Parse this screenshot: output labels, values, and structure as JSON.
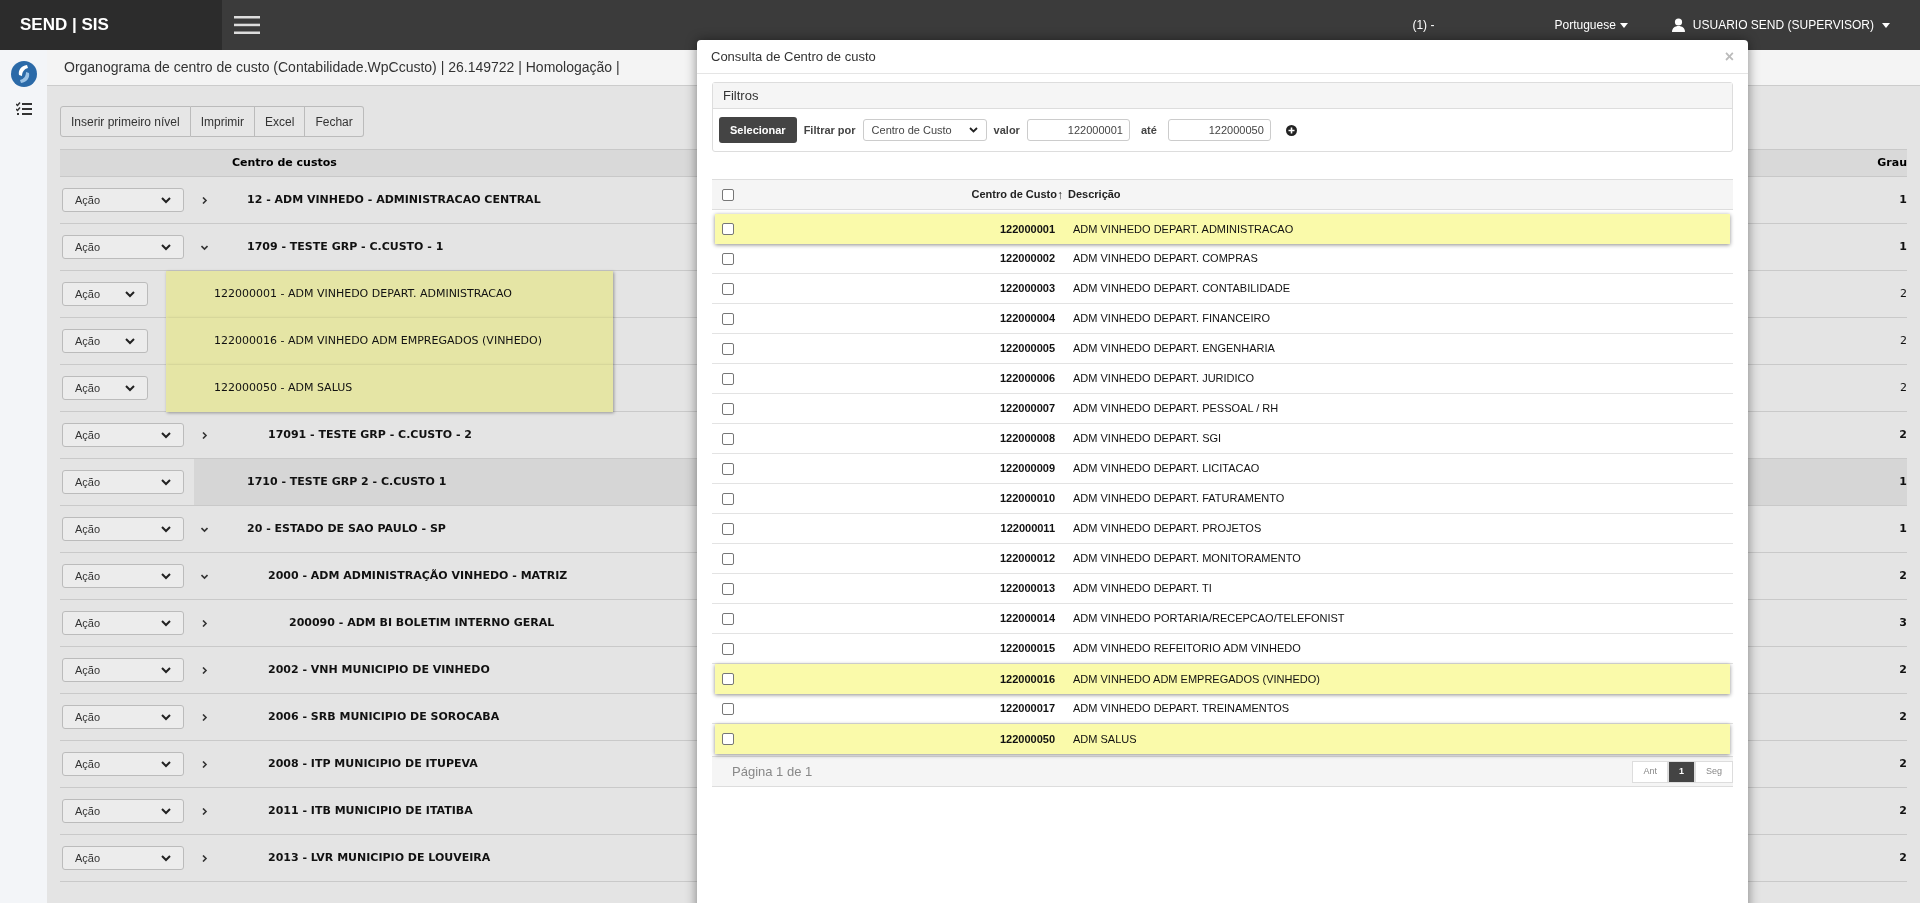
{
  "topbar": {
    "brand": "SEND | SIS",
    "notice": "(1) -",
    "language": "Portuguese",
    "user": "USUARIO SEND (SUPERVISOR)"
  },
  "breadcrumb": "Organograma de centro de custo (Contabilidade.WpCcusto) | 26.149722 | Homologação |",
  "toolbar": [
    "Inserir primeiro nível",
    "Imprimir",
    "Excel",
    "Fechar"
  ],
  "tree": {
    "columns": [
      "Centro de custos",
      "Grau"
    ],
    "rows": [
      {
        "kind": "group",
        "label": "12 - ADM VINHEDO - ADMINISTRACAO CENTRAL",
        "grau": "1",
        "action": "Ação",
        "selected": false,
        "expanded": false
      },
      {
        "kind": "group",
        "label": "1709 - TESTE GRP - C.CUSTO - 1",
        "grau": "1",
        "action": "Ação",
        "selected": false,
        "expanded": true,
        "children": [
          {
            "kind": "account",
            "label": "122000001 - ADM VINHEDO DEPART. ADMINISTRACAO",
            "grau": "2",
            "action": "Ação",
            "selected": false
          },
          {
            "kind": "account",
            "label": "122000016 - ADM VINHEDO ADM EMPREGADOS (VINHEDO)",
            "grau": "2",
            "action": "Ação",
            "selected": false
          },
          {
            "kind": "account",
            "label": "122000050 - ADM SALUS",
            "grau": "2",
            "action": "Ação",
            "selected": false
          },
          {
            "kind": "group",
            "label": "17091 - TESTE GRP - C.CUSTO - 2",
            "grau": "2",
            "action": "Ação",
            "selected": false,
            "expanded": false
          }
        ]
      },
      {
        "kind": "leaf",
        "label": "1710 - TESTE GRP 2 - C.CUSTO 1",
        "grau": "1",
        "action": "Ação",
        "selected": true
      },
      {
        "kind": "group",
        "label": "20 - ESTADO DE SAO PAULO - SP",
        "grau": "1",
        "action": "Ação",
        "selected": false,
        "expanded": true,
        "children": [
          {
            "kind": "group",
            "label": "2000 - ADM ADMINISTRAÇÃO VINHEDO - MATRIZ",
            "grau": "2",
            "action": "Ação",
            "selected": false,
            "expanded": true,
            "children": [
              {
                "kind": "group",
                "label": "200090 - ADM BI BOLETIM INTERNO GERAL",
                "grau": "3",
                "action": "Ação",
                "selected": false,
                "expanded": false
              }
            ]
          },
          {
            "kind": "group",
            "label": "2002 - VNH MUNICIPIO DE VINHEDO",
            "grau": "2",
            "action": "Ação",
            "selected": false,
            "expanded": false
          },
          {
            "kind": "group",
            "label": "2006 - SRB MUNICIPIO DE SOROCABA",
            "grau": "2",
            "action": "Ação",
            "selected": false,
            "expanded": false
          },
          {
            "kind": "group",
            "label": "2008 - ITP MUNICIPIO DE ITUPEVA",
            "grau": "2",
            "action": "Ação",
            "selected": false,
            "expanded": false
          },
          {
            "kind": "group",
            "label": "2011 - ITB MUNICIPIO DE ITATIBA",
            "grau": "2",
            "action": "Ação",
            "selected": false,
            "expanded": false
          },
          {
            "kind": "group",
            "label": "2013 - LVR MUNICIPIO DE LOUVEIRA",
            "grau": "2",
            "action": "Ação",
            "selected": false,
            "expanded": false
          }
        ]
      }
    ]
  },
  "modal": {
    "title": "Consulta de Centro de custo",
    "close": "×",
    "filters": {
      "title": "Filtros",
      "button": "Selecionar",
      "filter_label": "Filtrar por",
      "filter_select": "Centro de Custo",
      "value_label": "valor",
      "value": "122000001",
      "until_label": "até",
      "until_value": "122000050"
    },
    "table": {
      "columns": [
        "Centro de Custo",
        "Descrição"
      ],
      "sort_indicator": "↑",
      "all_checked": false,
      "rows": [
        {
          "code": "122000001",
          "description": "ADM VINHEDO DEPART. ADMINISTRACAO",
          "checked": false,
          "selected": true
        },
        {
          "code": "122000002",
          "description": "ADM VINHEDO DEPART. COMPRAS",
          "checked": false,
          "selected": false
        },
        {
          "code": "122000003",
          "description": "ADM VINHEDO DEPART. CONTABILIDADE",
          "checked": false,
          "selected": false
        },
        {
          "code": "122000004",
          "description": "ADM VINHEDO DEPART. FINANCEIRO",
          "checked": false,
          "selected": false
        },
        {
          "code": "122000005",
          "description": "ADM VINHEDO DEPART. ENGENHARIA",
          "checked": false,
          "selected": false
        },
        {
          "code": "122000006",
          "description": "ADM VINHEDO DEPART. JURIDICO",
          "checked": false,
          "selected": false
        },
        {
          "code": "122000007",
          "description": "ADM VINHEDO DEPART. PESSOAL / RH",
          "checked": false,
          "selected": false
        },
        {
          "code": "122000008",
          "description": "ADM VINHEDO DEPART. SGI",
          "checked": false,
          "selected": false
        },
        {
          "code": "122000009",
          "description": "ADM VINHEDO DEPART. LICITACAO",
          "checked": false,
          "selected": false
        },
        {
          "code": "122000010",
          "description": "ADM VINHEDO DEPART. FATURAMENTO",
          "checked": false,
          "selected": false
        },
        {
          "code": "122000011",
          "description": "ADM VINHEDO DEPART. PROJETOS",
          "checked": false,
          "selected": false
        },
        {
          "code": "122000012",
          "description": "ADM VINHEDO DEPART. MONITORAMENTO",
          "checked": false,
          "selected": false
        },
        {
          "code": "122000013",
          "description": "ADM VINHEDO DEPART. TI",
          "checked": false,
          "selected": false
        },
        {
          "code": "122000014",
          "description": "ADM VINHEDO PORTARIA/RECEPCAO/TELEFONIST",
          "checked": false,
          "selected": false
        },
        {
          "code": "122000015",
          "description": "ADM VINHEDO REFEITORIO ADM VINHEDO",
          "checked": false,
          "selected": false
        },
        {
          "code": "122000016",
          "description": "ADM VINHEDO ADM EMPREGADOS (VINHEDO)",
          "checked": false,
          "selected": true
        },
        {
          "code": "122000017",
          "description": "ADM VINHEDO DEPART. TREINAMENTOS",
          "checked": false,
          "selected": false
        },
        {
          "code": "122000050",
          "description": "ADM SALUS",
          "checked": false,
          "selected": true
        }
      ]
    },
    "footer": {
      "page_info": "Página 1 de 1",
      "pages": [
        {
          "label": "Ant",
          "selected": false
        },
        {
          "label": "1",
          "selected": true
        },
        {
          "label": "Seg",
          "selected": false
        }
      ]
    }
  }
}
